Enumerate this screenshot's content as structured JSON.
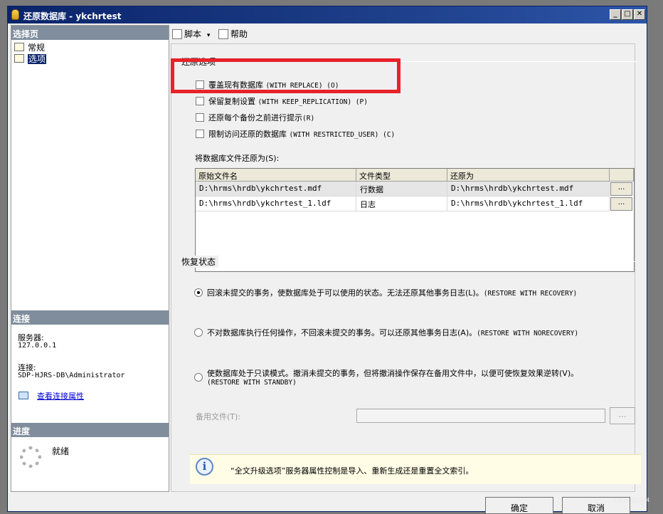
{
  "window": {
    "title": "还原数据库 - ykchrtest"
  },
  "titlebar_buttons": {
    "minimize": "_",
    "maximize": "□",
    "close": "✕"
  },
  "left": {
    "select_page_header": "选择页",
    "pages": [
      {
        "label": "常规"
      },
      {
        "label": "选项"
      }
    ],
    "connection_header": "连接",
    "server_label": "服务器:",
    "server_value": "127.0.0.1",
    "connection_label": "连接:",
    "connection_value": "SDP-HJRS-DB\\Administrator",
    "view_props_link": "查看连接属性",
    "progress_header": "进度",
    "progress_status": "就绪"
  },
  "toolbar": {
    "script_label": "脚本",
    "script_dropdown": "▾",
    "help_label": "帮助"
  },
  "restore_options": {
    "group_label": "还原选项",
    "options": [
      {
        "zh": "覆盖现有数据库",
        "en": "(WITH REPLACE) (O)",
        "checked": false
      },
      {
        "zh": "保留复制设置",
        "en": "(WITH KEEP_REPLICATION) (P)",
        "checked": false
      },
      {
        "zh": "还原每个备份之前进行提示",
        "en": "(R)",
        "checked": false
      },
      {
        "zh": "限制访问还原的数据库",
        "en": "(WITH RESTRICTED_USER) (C)",
        "checked": false
      }
    ]
  },
  "file_grid": {
    "label": "将数据库文件还原为(S):",
    "columns": [
      "原始文件名",
      "文件类型",
      "还原为"
    ],
    "rows": [
      {
        "original": "D:\\hrms\\hrdb\\ykchrtest.mdf",
        "type": "行数据",
        "restore_as": "D:\\hrms\\hrdb\\ykchrtest.mdf",
        "button": "..."
      },
      {
        "original": "D:\\hrms\\hrdb\\ykchrtest_1.ldf",
        "type": "日志",
        "restore_as": "D:\\hrms\\hrdb\\ykchrtest_1.ldf",
        "button": "..."
      }
    ]
  },
  "recovery_state": {
    "group_label": "恢复状态",
    "options": [
      {
        "zh": "回滚未提交的事务，使数据库处于可以使用的状态。无法还原其他事务日志(L)。",
        "en": "(RESTORE WITH RECOVERY)",
        "selected": true
      },
      {
        "zh": "不对数据库执行任何操作，不回滚未提交的事务。可以还原其他事务日志(A)。",
        "en": "(RESTORE WITH NORECOVERY)",
        "selected": false
      },
      {
        "zh": "使数据库处于只读模式。撤消未提交的事务，但将撤消操作保存在备用文件中，以便可使恢复效果逆转(V)。",
        "en": "(RESTORE WITH STANDBY)",
        "selected": false
      }
    ],
    "standby_file_label": "备用文件(T):",
    "standby_file_value": "",
    "standby_browse": "..."
  },
  "info": {
    "icon": "i",
    "message": "“全文升级选项”服务器属性控制是导入、重新生成还是重置全文索引。"
  },
  "buttons": {
    "ok": "确定",
    "cancel": "取消"
  },
  "watermark": "CSDN @QQ4",
  "colors": {
    "highlight": "#e8222a",
    "titlebar": "#0a246a",
    "section_header": "#7f8d9c"
  }
}
